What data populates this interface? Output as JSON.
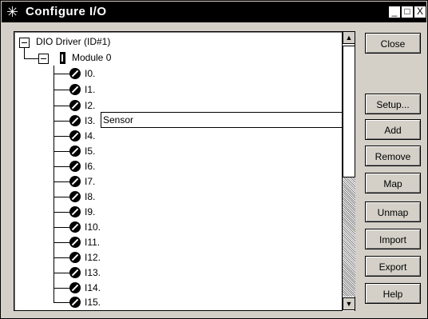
{
  "window": {
    "title": "Configure I/O"
  },
  "title_controls": [
    "_",
    "□",
    "X"
  ],
  "tree": {
    "root_label": "DIO Driver (ID#1)",
    "module_label": "Module 0",
    "editing_value": "Sensor",
    "items": [
      "I0.",
      "I1.",
      "I2.",
      "I3.",
      "I4.",
      "I5.",
      "I6.",
      "I7.",
      "I8.",
      "I9.",
      "I10.",
      "I11.",
      "I12.",
      "I13.",
      "I14.",
      "I15."
    ]
  },
  "buttons": {
    "close": "Close",
    "setup": "Setup...",
    "add": "Add",
    "remove": "Remove",
    "map": "Map",
    "unmap": "Unmap",
    "import": "Import",
    "export": "Export",
    "help": "Help"
  },
  "icons": {
    "window": "configure-io-icon",
    "root": "collapse-icon",
    "module": "module-icon",
    "io": "io-point-icon"
  },
  "colors": {
    "titlebar": "#000000",
    "window": "#d4d0c8",
    "panel": "#ffffff"
  }
}
